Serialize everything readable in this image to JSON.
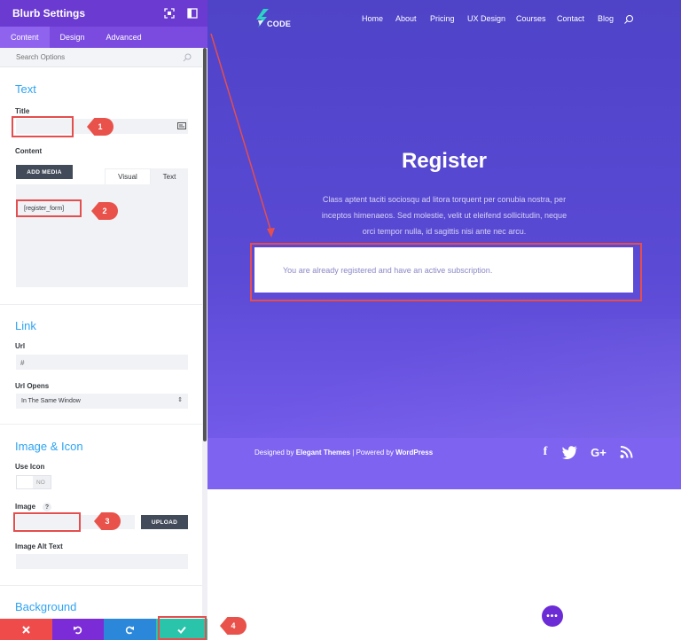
{
  "panel": {
    "title": "Blurb Settings",
    "tabs": [
      "Content",
      "Design",
      "Advanced"
    ],
    "search_placeholder": "Search Options",
    "text_section": {
      "heading": "Text",
      "title_label": "Title",
      "content_label": "Content",
      "add_media_label": "ADD MEDIA",
      "editor_tabs": [
        "Visual",
        "Text"
      ],
      "content_value": "[register_form]"
    },
    "link_section": {
      "heading": "Link",
      "url_label": "Url",
      "url_value": "#",
      "url_opens_label": "Url Opens",
      "url_opens_value": "In The Same Window"
    },
    "image_section": {
      "heading": "Image & Icon",
      "use_icon_label": "Use Icon",
      "toggle_value": "NO",
      "image_label": "Image",
      "help": "?",
      "upload_label": "UPLOAD",
      "alt_label": "Image Alt Text"
    },
    "background_section": {
      "heading": "Background"
    }
  },
  "preview": {
    "logo_text": "CODE",
    "nav": [
      "Home",
      "About",
      "Pricing",
      "UX Design",
      "Courses",
      "Contact",
      "Blog"
    ],
    "hero_title": "Register",
    "hero_lines": [
      "Class aptent taciti sociosqu ad litora torquent per conubia nostra, per",
      "inceptos himenaeos. Sed molestie, velit ut eleifend sollicitudin, neque",
      "orci tempor nulla, id sagittis nisi ante nec arcu."
    ],
    "message": "You are already registered and have an active subscription.",
    "credit_prefix": "Designed by ",
    "credit_brand1": "Elegant Themes",
    "credit_mid": " | Powered by ",
    "credit_brand2": "WordPress",
    "social_labels": [
      "f",
      "G+"
    ],
    "fab_label": "•••"
  },
  "annotations": [
    "1",
    "2",
    "3",
    "4"
  ],
  "colors": {
    "panel_header": "#6b3ad0",
    "accent_blue": "#2ea3f2",
    "cancel": "#ef4b4b",
    "undo": "#7b2cd6",
    "redo": "#2b87da",
    "save": "#29c4a9",
    "annotation_red": "#e44e4e"
  },
  "icons": [
    "fullscreen-icon",
    "split-view-icon",
    "search-icon",
    "close-icon",
    "undo-icon",
    "redo-icon",
    "check-icon",
    "facebook-icon",
    "twitter-icon",
    "google-plus-icon",
    "rss-icon",
    "dynamic-content-icon",
    "select-arrow-icon"
  ]
}
